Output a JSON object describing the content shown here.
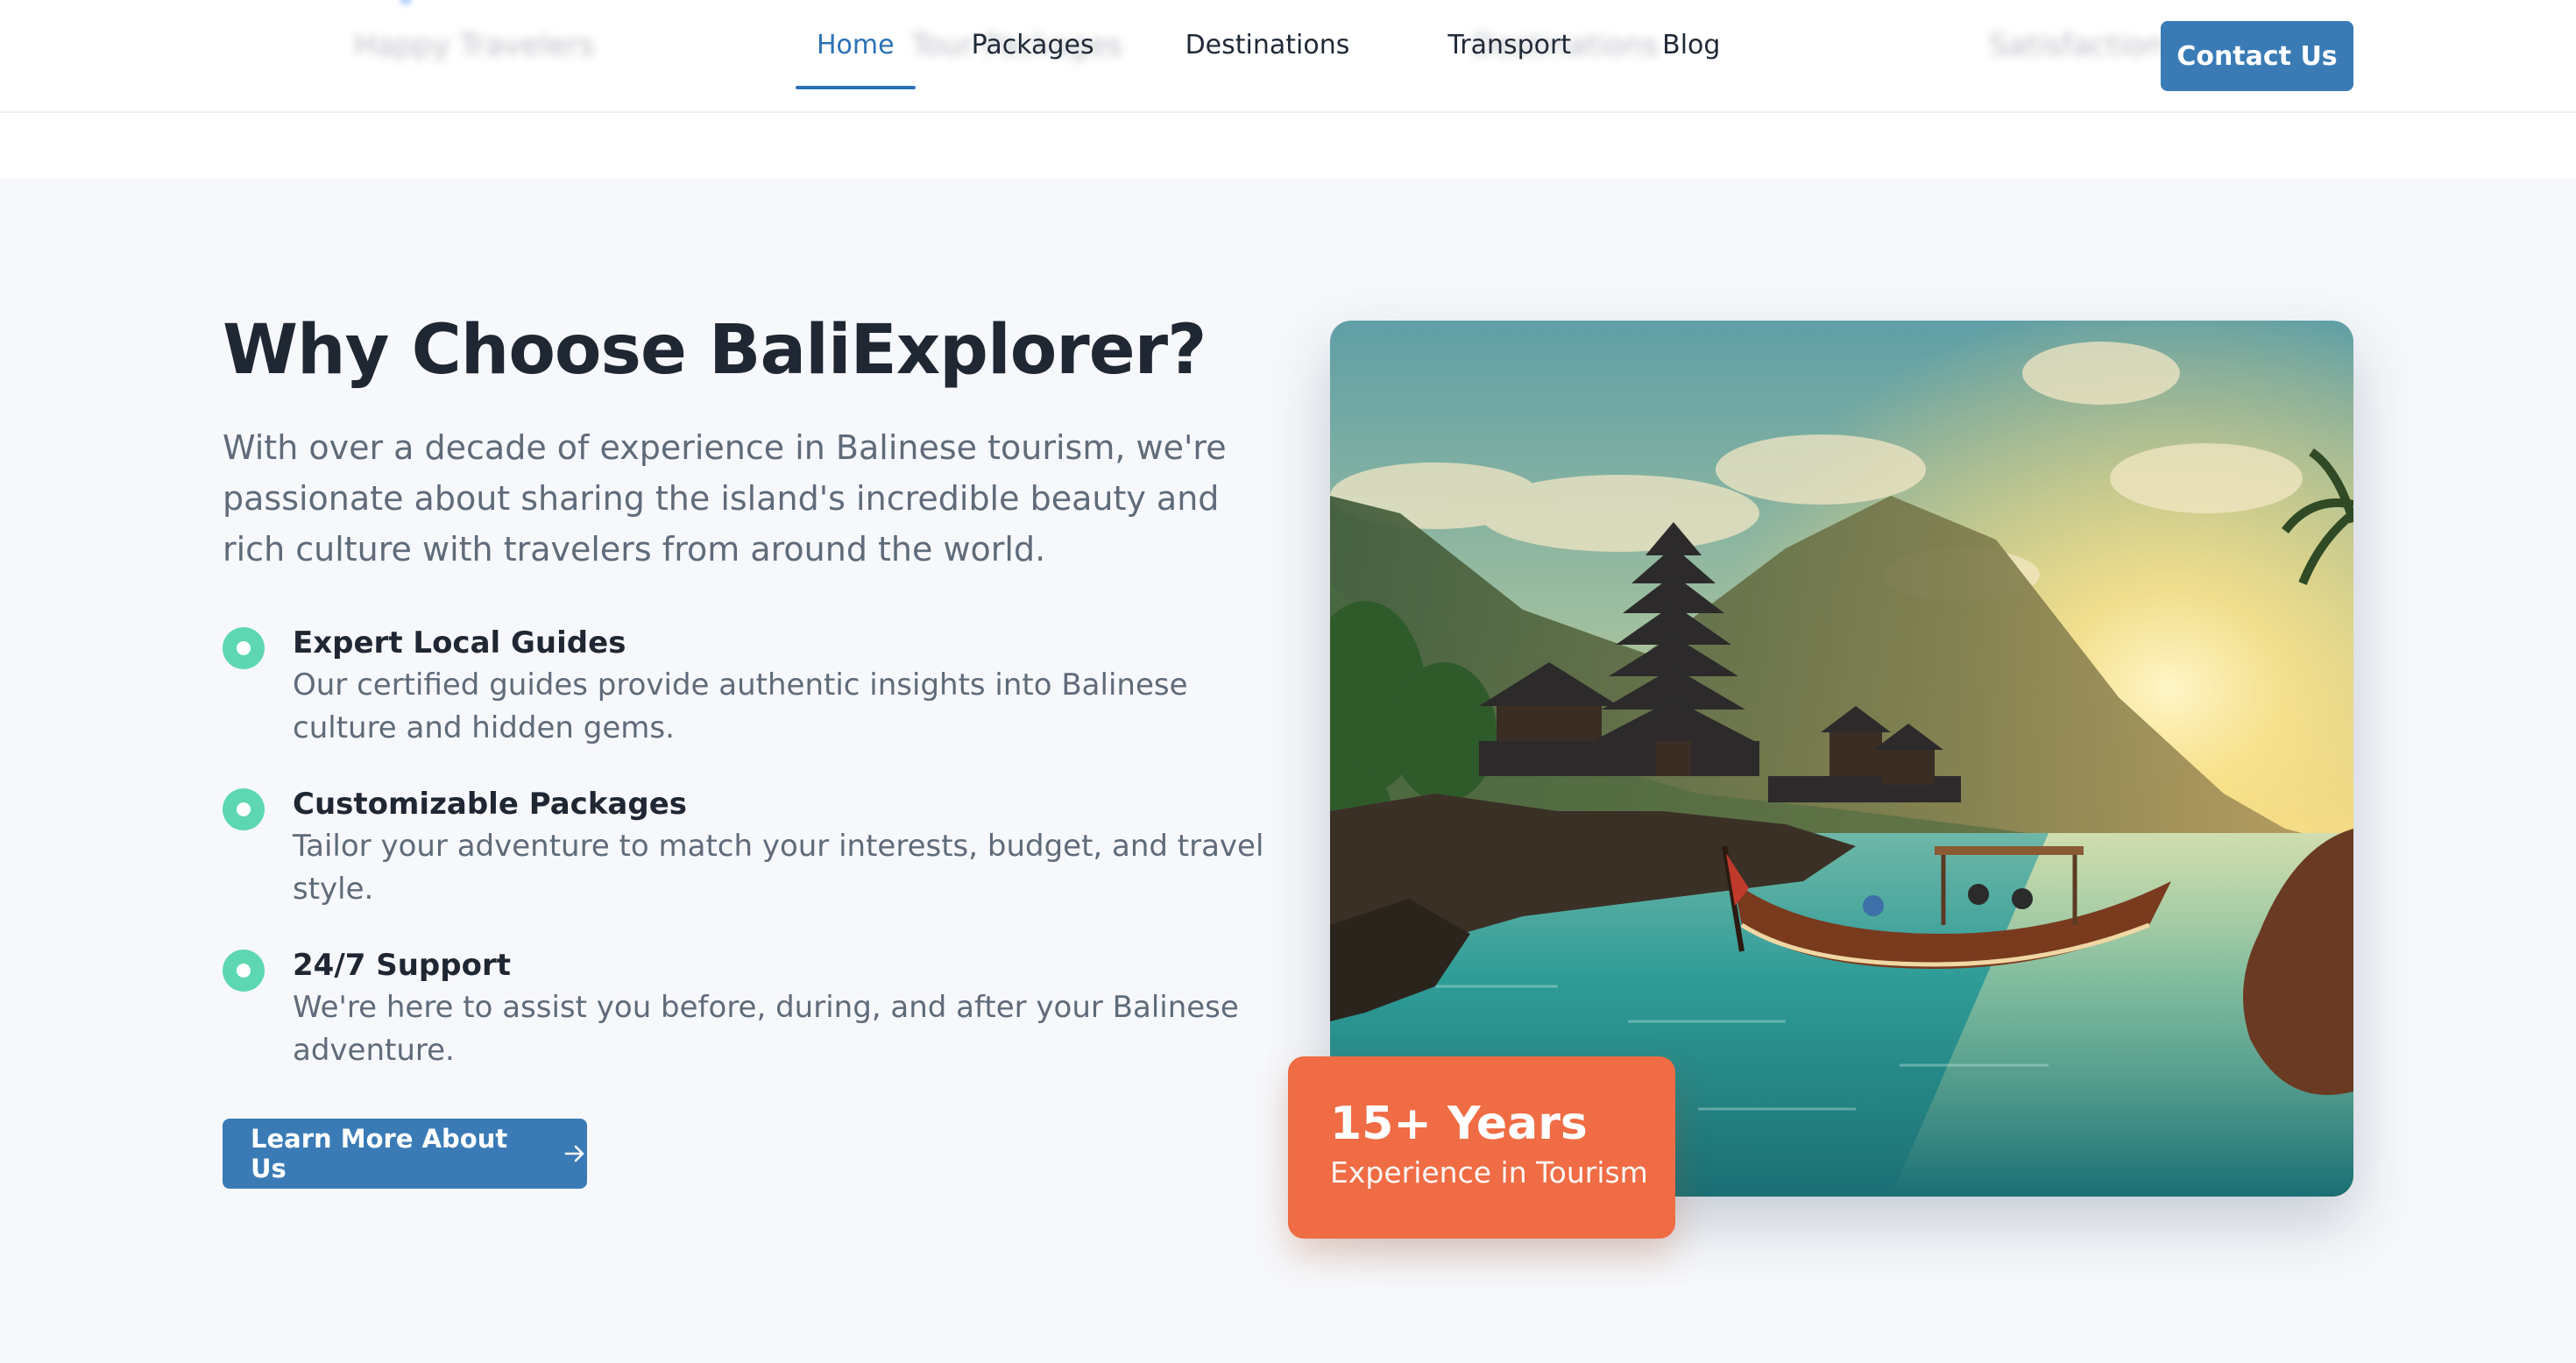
{
  "nav": {
    "background_labels": [
      "Happy Travelers",
      "Tour Packages",
      "Destinations",
      "Satisfaction"
    ],
    "links": [
      {
        "label": "Home",
        "active": true
      },
      {
        "label": "Packages",
        "active": false
      },
      {
        "label": "Destinations",
        "active": false
      },
      {
        "label": "Transport",
        "active": false
      },
      {
        "label": "Blog",
        "active": false
      }
    ],
    "contact_label": "Contact Us"
  },
  "about": {
    "heading": "Why Choose BaliExplorer?",
    "intro": "With over a decade of experience in Balinese tourism, we're passionate about sharing the island's incredible beauty and rich culture with travelers from around the world.",
    "features": [
      {
        "title": "Expert Local Guides",
        "description": "Our certified guides provide authentic insights into Balinese culture and hidden gems."
      },
      {
        "title": "Customizable Packages",
        "description": "Tailor your adventure to match your interests, budget, and travel style."
      },
      {
        "title": "24/7 Support",
        "description": "We're here to assist you before, during, and after your Balinese adventure."
      }
    ],
    "cta_label": "Learn More About Us",
    "cta_icon": "arrow-right-icon",
    "image_subject": "temple-lake-sunset-boat",
    "badge": {
      "value": "15+ Years",
      "label": "Experience in Tourism"
    }
  },
  "colors": {
    "primary": "#3a7bb6",
    "active_link": "#2b72b6",
    "accent_badge": "#ef6c44",
    "feature_dot": "#5dd7b1",
    "section_bg": "#f6f8fb"
  }
}
